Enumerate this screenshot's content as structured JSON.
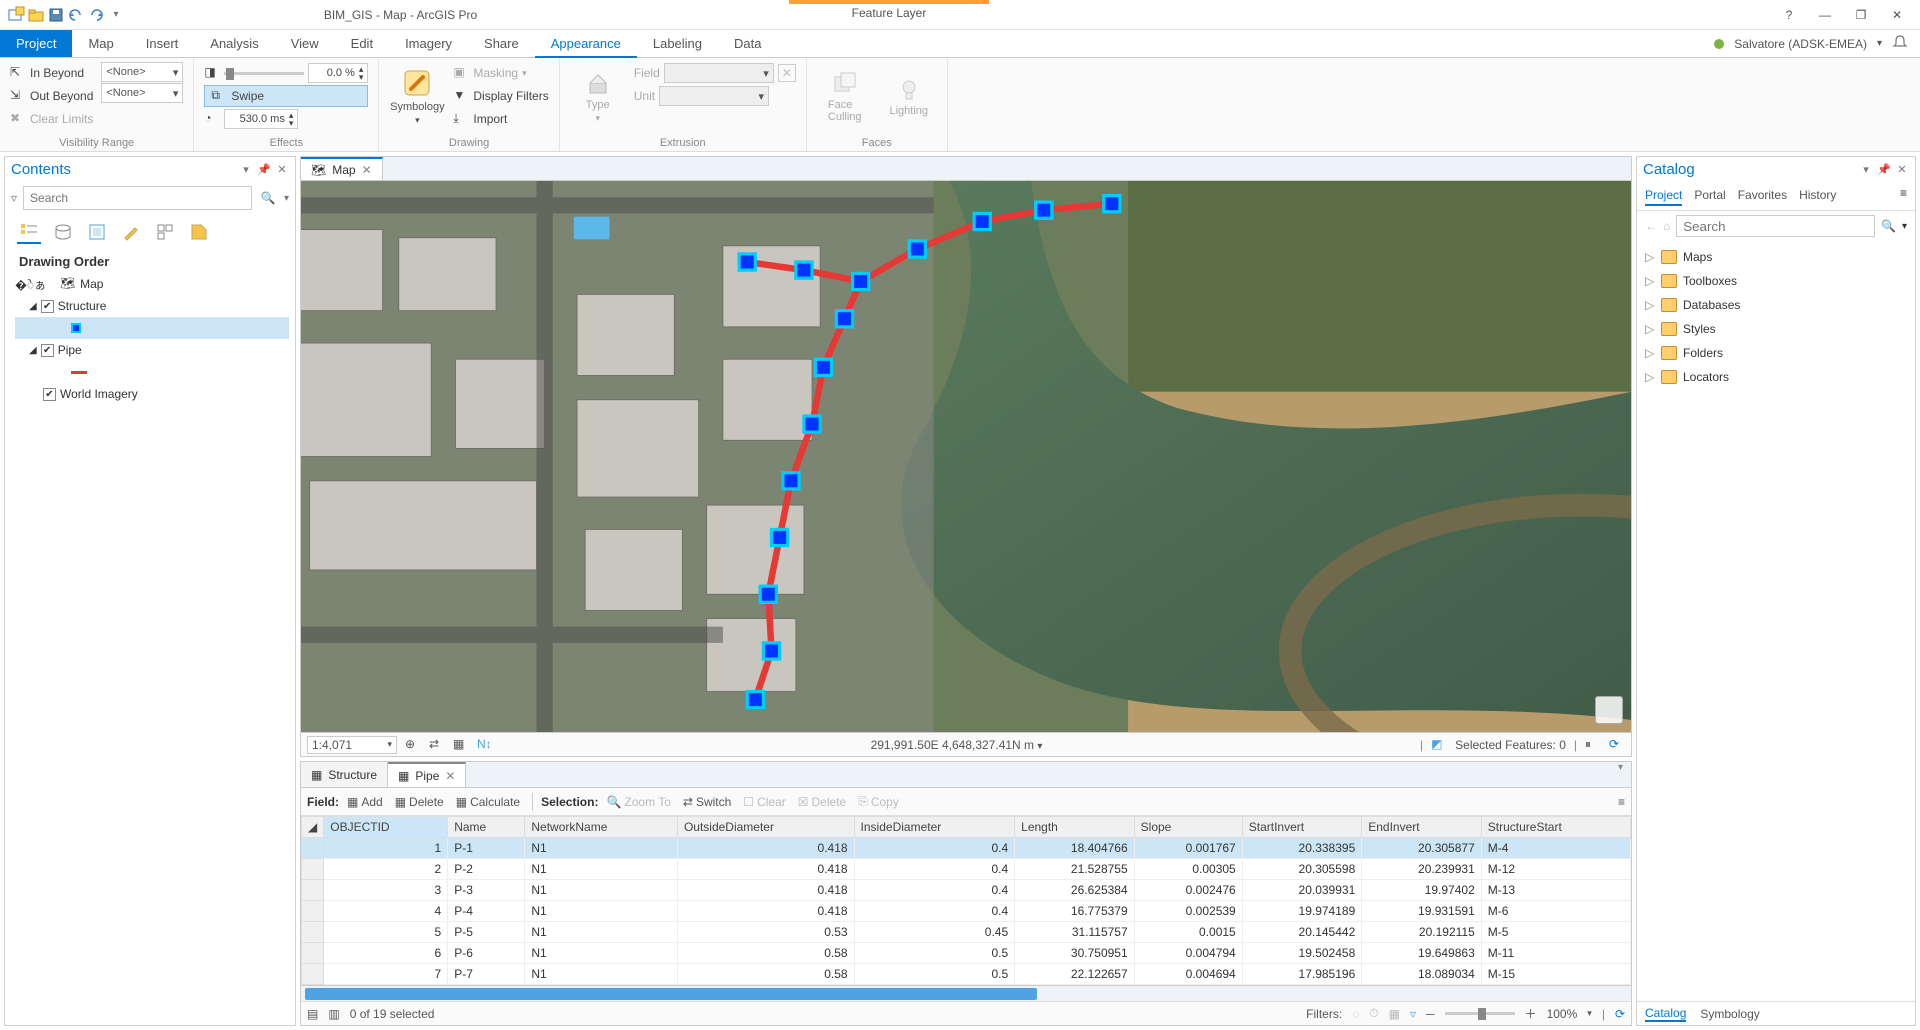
{
  "titlebar": {
    "app_title": "BIM_GIS - Map - ArcGIS Pro",
    "context_title": "Feature Layer"
  },
  "win": {
    "help": "?",
    "min": "—",
    "max": "❐",
    "close": "✕"
  },
  "tabs": {
    "file": "Project",
    "map": "Map",
    "insert": "Insert",
    "analysis": "Analysis",
    "view": "View",
    "edit": "Edit",
    "imagery": "Imagery",
    "share": "Share",
    "appearance": "Appearance",
    "labeling": "Labeling",
    "data": "Data"
  },
  "user": {
    "name": "Salvatore (ADSK-EMEA)"
  },
  "ribbon": {
    "vis_range": {
      "in_beyond": "In Beyond",
      "out_beyond": "Out Beyond",
      "clear": "Clear Limits",
      "none": "<None>",
      "group": "Visibility Range"
    },
    "effects": {
      "swipe": "Swipe",
      "ms": "530.0  ms",
      "pct": "0.0  %",
      "group": "Effects"
    },
    "drawing": {
      "symbology": "Symbology",
      "masking": "Masking",
      "display_filters": "Display Filters",
      "import": "Import",
      "group": "Drawing"
    },
    "extrusion": {
      "type": "Type",
      "field": "Field",
      "unit": "Unit",
      "group": "Extrusion"
    },
    "faces": {
      "face_culling": "Face\nCulling",
      "lighting": "Lighting",
      "group": "Faces"
    }
  },
  "contents": {
    "title": "Contents",
    "search_ph": "Search",
    "drawing_order": "Drawing Order",
    "map": "Map",
    "structure": "Structure",
    "pipe": "Pipe",
    "world_imagery": "World Imagery"
  },
  "map": {
    "tab": "Map",
    "scale": "1:4,071",
    "coords": "291,991.50E 4,648,327.41N m",
    "selected": "Selected Features: 0"
  },
  "attr": {
    "tab_structure": "Structure",
    "tab_pipe": "Pipe",
    "field": "Field:",
    "add": "Add",
    "delete": "Delete",
    "calculate": "Calculate",
    "selection": "Selection:",
    "zoom_to": "Zoom To",
    "switch": "Switch",
    "clear": "Clear",
    "delete2": "Delete",
    "copy": "Copy",
    "cols": [
      "OBJECTID",
      "Name",
      "NetworkName",
      "OutsideDiameter",
      "InsideDiameter",
      "Length",
      "Slope",
      "StartInvert",
      "EndInvert",
      "StructureStart"
    ],
    "rows": [
      {
        "id": "1",
        "name": "P-1",
        "net": "N1",
        "od": "0.418",
        "idm": "0.4",
        "len": "18.404766",
        "slope": "0.001767",
        "si": "20.338395",
        "ei": "20.305877",
        "ss": "M-4"
      },
      {
        "id": "2",
        "name": "P-2",
        "net": "N1",
        "od": "0.418",
        "idm": "0.4",
        "len": "21.528755",
        "slope": "0.00305",
        "si": "20.305598",
        "ei": "20.239931",
        "ss": "M-12"
      },
      {
        "id": "3",
        "name": "P-3",
        "net": "N1",
        "od": "0.418",
        "idm": "0.4",
        "len": "26.625384",
        "slope": "0.002476",
        "si": "20.039931",
        "ei": "19.97402",
        "ss": "M-13"
      },
      {
        "id": "4",
        "name": "P-4",
        "net": "N1",
        "od": "0.418",
        "idm": "0.4",
        "len": "16.775379",
        "slope": "0.002539",
        "si": "19.974189",
        "ei": "19.931591",
        "ss": "M-6"
      },
      {
        "id": "5",
        "name": "P-5",
        "net": "N1",
        "od": "0.53",
        "idm": "0.45",
        "len": "31.115757",
        "slope": "0.0015",
        "si": "20.145442",
        "ei": "20.192115",
        "ss": "M-5"
      },
      {
        "id": "6",
        "name": "P-6",
        "net": "N1",
        "od": "0.58",
        "idm": "0.5",
        "len": "30.750951",
        "slope": "0.004794",
        "si": "19.502458",
        "ei": "19.649863",
        "ss": "M-11"
      },
      {
        "id": "7",
        "name": "P-7",
        "net": "N1",
        "od": "0.58",
        "idm": "0.5",
        "len": "22.122657",
        "slope": "0.004694",
        "si": "17.985196",
        "ei": "18.089034",
        "ss": "M-15"
      }
    ],
    "footer_count": "0 of 19 selected",
    "filters": "Filters:",
    "zoom": "100%"
  },
  "catalog": {
    "title": "Catalog",
    "tabs": {
      "project": "Project",
      "portal": "Portal",
      "favorites": "Favorites",
      "history": "History"
    },
    "search_ph": "Search",
    "items": [
      "Maps",
      "Toolboxes",
      "Databases",
      "Styles",
      "Folders",
      "Locators"
    ],
    "bottom": {
      "catalog": "Catalog",
      "symbology": "Symbology"
    }
  }
}
